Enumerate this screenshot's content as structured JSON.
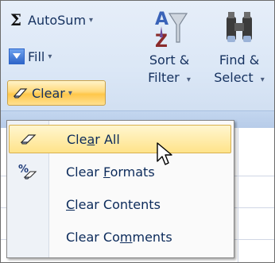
{
  "ribbon": {
    "autosum": {
      "label": "AutoSum",
      "caret": "▾",
      "icon": "sigma-icon"
    },
    "fill": {
      "label": "Fill",
      "caret": "▾",
      "icon": "fill-down-icon"
    },
    "clear": {
      "label": "Clear",
      "caret": "▾",
      "icon": "eraser-icon"
    },
    "sort_filter": {
      "line1": "Sort &",
      "line2": "Filter",
      "caret": "▾",
      "icon": "sort-az-funnel-icon"
    },
    "find_select": {
      "line1": "Find &",
      "line2": "Select",
      "caret": "▾",
      "icon": "binoculars-icon"
    }
  },
  "menu": {
    "items": [
      {
        "pre": "Cle",
        "key": "a",
        "post": "r All",
        "icon": "eraser-icon",
        "highlighted": true
      },
      {
        "pre": "Clear ",
        "key": "F",
        "post": "ormats",
        "icon": "clear-formats-icon",
        "highlighted": false
      },
      {
        "pre": "",
        "key": "C",
        "post": "lear Contents",
        "icon": "",
        "highlighted": false
      },
      {
        "pre": "Clear Co",
        "key": "m",
        "post": "ments",
        "icon": "",
        "highlighted": false
      }
    ]
  },
  "colors": {
    "menu_highlight": "#ffe38a",
    "ribbon_bg": "#dbe7f6",
    "text": "#15315f"
  }
}
